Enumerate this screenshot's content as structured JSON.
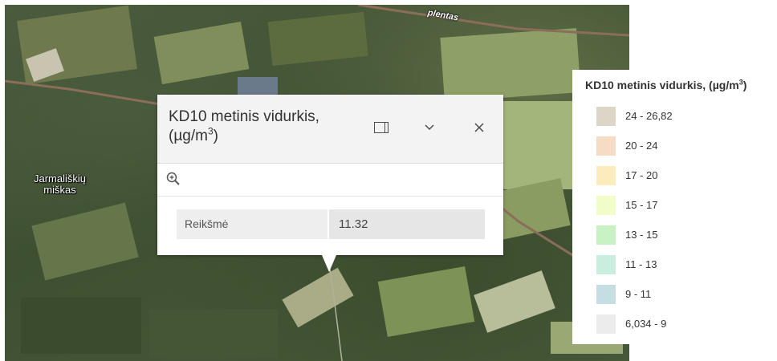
{
  "map": {
    "place_label_line1": "Jarmališkių",
    "place_label_line2": "miškas",
    "road_label": "plentas"
  },
  "popup": {
    "title_line1": "KD10 metinis vidurkis,",
    "title_unit_prefix": "(µg/m",
    "title_unit_sup": "3",
    "title_unit_suffix": ")",
    "dock_icon": "dock-icon",
    "collapse_icon": "chevron-down-icon",
    "collapse_glyph": "⌄",
    "close_icon": "close-icon",
    "close_glyph": "✕",
    "zoom_icon": "zoom-to-icon",
    "attribute": {
      "label": "Reikšmė",
      "value": "11.32"
    }
  },
  "legend": {
    "title_prefix": "KD10 metinis vidurkis, (µg/m",
    "title_sup": "3",
    "title_suffix": ")",
    "items": [
      {
        "label": "24 - 26,82",
        "color": "#ddd6c6"
      },
      {
        "label": "20 - 24",
        "color": "#f6dcc4"
      },
      {
        "label": "17 - 20",
        "color": "#fbecbe"
      },
      {
        "label": "15 - 17",
        "color": "#f2fcc8"
      },
      {
        "label": "13 - 15",
        "color": "#c8f2c4"
      },
      {
        "label": "11 - 13",
        "color": "#c9eedd"
      },
      {
        "label": "9 - 11",
        "color": "#c6dde4"
      },
      {
        "label": "6,034 - 9",
        "color": "#ececec"
      }
    ]
  }
}
